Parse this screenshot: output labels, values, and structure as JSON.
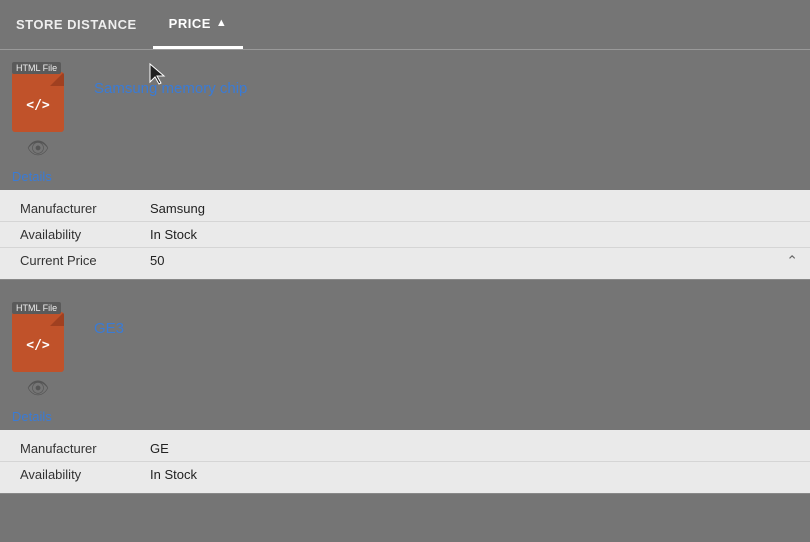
{
  "tabs": [
    {
      "id": "store-distance",
      "label": "STORE DISTANCE",
      "active": false
    },
    {
      "id": "price",
      "label": "PRICE",
      "active": true,
      "sort": "asc"
    }
  ],
  "products": [
    {
      "id": "samsung-memory-chip",
      "file_badge": "HTML File",
      "file_code": "</>",
      "title": "Samsung memory chip",
      "details_label": "Details",
      "details": [
        {
          "label": "Manufacturer",
          "value": "Samsung"
        },
        {
          "label": "Availability",
          "value": "In Stock"
        },
        {
          "label": "Current Price",
          "value": "50"
        }
      ],
      "collapsed": true
    },
    {
      "id": "ge3",
      "file_badge": "HTML File",
      "file_code": "</>",
      "title": "GE3",
      "details_label": "Details",
      "details": [
        {
          "label": "Manufacturer",
          "value": "GE"
        },
        {
          "label": "Availability",
          "value": "In Stock"
        }
      ],
      "collapsed": false
    }
  ],
  "icons": {
    "sort_asc": "▲",
    "eye": "👁",
    "collapse": "⌃"
  }
}
